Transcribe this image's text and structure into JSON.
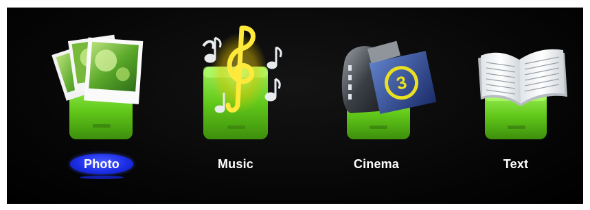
{
  "menu": {
    "items": [
      {
        "label": "Photo",
        "icon": "photo-stack-icon",
        "selected": true
      },
      {
        "label": "Music",
        "icon": "music-notes-icon",
        "selected": false
      },
      {
        "label": "Cinema",
        "icon": "film-reel-icon",
        "selected": false
      },
      {
        "label": "Text",
        "icon": "open-book-icon",
        "selected": false
      }
    ]
  },
  "colors": {
    "background": "#000000",
    "drawer_green": "#6fd31f",
    "selection_blue": "#1c2fe6",
    "label_text": "#ffffff"
  },
  "cinema_badge_text": "3"
}
